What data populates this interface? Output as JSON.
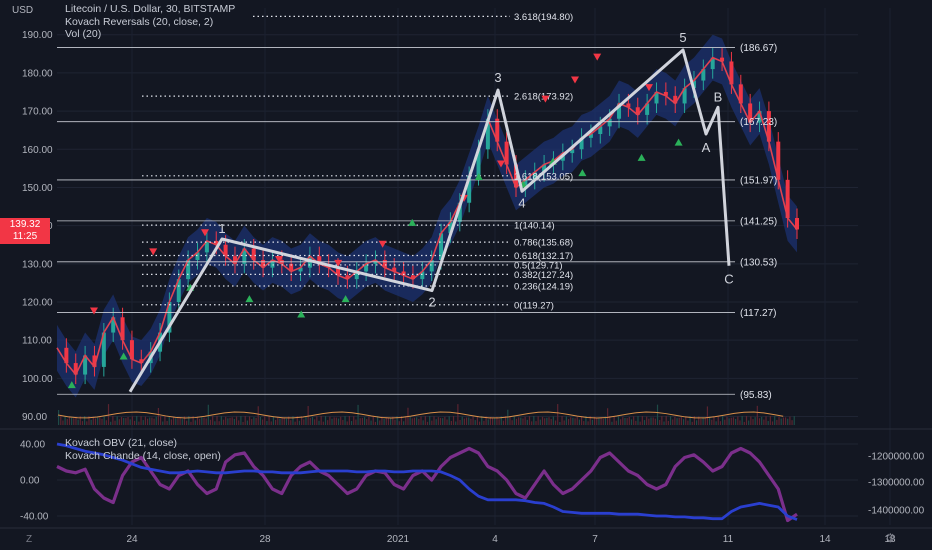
{
  "header": {
    "currency": "USD"
  },
  "legend": {
    "main": "Litecoin / U.S. Dollar, 30, BITSTAMP",
    "ind1": "Kovach Reversals (20, close, 2)",
    "ind2": "Vol (20)"
  },
  "lower_legend": {
    "ind1": "Kovach OBV (21, close)",
    "ind2": "Kovach Chande (14, close, open)"
  },
  "price_tag": {
    "price": "139.32",
    "time": "11:25"
  },
  "bottom_bar": {
    "z_label": "Z",
    "settings_icon": "gear-icon"
  },
  "colors": {
    "bg": "#131722",
    "red": "#f23645",
    "green": "#26a69a",
    "wave": "#d1d4dc",
    "obv": "#2a3fcf",
    "chande": "#7b2f8b"
  },
  "chart_data": [
    {
      "type": "line",
      "title": "Litecoin / U.S. Dollar, 30, BITSTAMP",
      "y_ticks": [
        90,
        100,
        110,
        120,
        130,
        140,
        150,
        160,
        170,
        180,
        190
      ],
      "y_tick_labels": [
        "90.00",
        "100.00",
        "110.00",
        "120.00",
        "130.00",
        "140.00",
        "150.00",
        "160.00",
        "170.00",
        "180.00",
        "190.00"
      ],
      "x_tick_labels": [
        "24",
        "28",
        "2021",
        "4",
        "7",
        "11",
        "14",
        "18"
      ],
      "ylim": [
        87,
        197
      ],
      "grid": true,
      "elliott_wave": {
        "points": [
          [
            "0",
            96.5
          ],
          [
            "1",
            136.5
          ],
          [
            "2",
            123
          ],
          [
            "3",
            175.5
          ],
          [
            "4",
            149
          ],
          [
            "5",
            186
          ],
          [
            "A",
            164
          ],
          [
            "B",
            171
          ],
          [
            "C",
            129.5
          ]
        ],
        "labels": [
          "1",
          "2",
          "3",
          "4",
          "5",
          "A",
          "B",
          "C"
        ]
      },
      "price_series": {
        "name": "close",
        "values": [
          108,
          104,
          101,
          106,
          103,
          112,
          116,
          110,
          105,
          104,
          107,
          112,
          120,
          126,
          131,
          133,
          136,
          135,
          132,
          130,
          134,
          131,
          129,
          131,
          130,
          128,
          129,
          132,
          130,
          129,
          127,
          126,
          128,
          130,
          131,
          129,
          128,
          127,
          126,
          128,
          131,
          138,
          141,
          146,
          153,
          160,
          168,
          162,
          156,
          150,
          152,
          154,
          156,
          157,
          159,
          160,
          163,
          164,
          166,
          168,
          172,
          171,
          169,
          172,
          175,
          174,
          172,
          176,
          178,
          181,
          184,
          183,
          177,
          172,
          167,
          170,
          162,
          152,
          142,
          139
        ]
      },
      "fib_levels": [
        {
          "label": "3.618(194.80)",
          "value": 194.8
        },
        {
          "label": "2.618(173.92)",
          "value": 173.92
        },
        {
          "label": "1.618(153.05)",
          "value": 153.05
        },
        {
          "label": "1(140.14)",
          "value": 140.14
        },
        {
          "label": "0.786(135.68)",
          "value": 135.68
        },
        {
          "label": "0.618(132.17)",
          "value": 132.17
        },
        {
          "label": "0.5(129.71)",
          "value": 129.71
        },
        {
          "label": "0.382(127.24)",
          "value": 127.24
        },
        {
          "label": "0.236(124.19)",
          "value": 124.19
        },
        {
          "label": "0(119.27)",
          "value": 119.27
        }
      ],
      "horizontal_levels": [
        {
          "label": "(186.67)",
          "value": 186.67
        },
        {
          "label": "(167.23)",
          "value": 167.23
        },
        {
          "label": "(151.97)",
          "value": 151.97
        },
        {
          "label": "(141.25)",
          "value": 141.25
        },
        {
          "label": "(130.53)",
          "value": 130.53
        },
        {
          "label": "(117.27)",
          "value": 117.27
        },
        {
          "label": "(95.83)",
          "value": 95.83
        }
      ],
      "reversal_markers": {
        "down": [
          [
            0.05,
            117.5
          ],
          [
            0.13,
            133
          ],
          [
            0.2,
            138
          ],
          [
            0.3,
            131
          ],
          [
            0.38,
            130
          ],
          [
            0.44,
            135
          ],
          [
            0.55,
            147
          ],
          [
            0.6,
            156
          ],
          [
            0.66,
            173
          ],
          [
            0.7,
            178
          ],
          [
            0.73,
            184
          ],
          [
            0.8,
            176
          ]
        ],
        "up": [
          [
            0.02,
            98.5
          ],
          [
            0.09,
            106
          ],
          [
            0.18,
            124
          ],
          [
            0.26,
            121
          ],
          [
            0.33,
            117
          ],
          [
            0.39,
            121
          ],
          [
            0.48,
            141
          ],
          [
            0.57,
            153
          ],
          [
            0.63,
            151
          ],
          [
            0.67,
            157
          ],
          [
            0.71,
            154
          ],
          [
            0.79,
            158
          ],
          [
            0.84,
            162
          ]
        ]
      }
    },
    {
      "type": "line",
      "title": "Kovach OBV / Kovach Chande",
      "left_y_tick_labels": [
        "40.00",
        "0.00",
        "-40.00"
      ],
      "left_y_ticks": [
        40,
        0,
        -40
      ],
      "right_y_tick_labels": [
        "-1200000.00",
        "-1300000.00",
        "-1400000.00"
      ],
      "series": [
        {
          "name": "Kovach OBV (21, close)",
          "values": [
            40,
            38,
            35,
            32,
            30,
            28,
            25,
            22,
            18,
            14,
            12,
            10,
            8,
            8,
            9,
            10,
            9,
            8,
            8,
            9,
            10,
            10,
            9,
            9,
            8,
            8,
            8,
            9,
            10,
            10,
            10,
            10,
            9,
            9,
            10,
            10,
            9,
            9,
            10,
            10,
            10,
            9,
            5,
            0,
            -10,
            -18,
            -22,
            -22,
            -22,
            -22,
            -23,
            -25,
            -26,
            -30,
            -35,
            -36,
            -37,
            -37,
            -37,
            -37,
            -38,
            -38,
            -38,
            -39,
            -40,
            -40,
            -41,
            -41,
            -42,
            -42,
            -43,
            -43,
            -35,
            -30,
            -28,
            -26,
            -28,
            -30,
            -40,
            -44
          ]
        },
        {
          "name": "Kovach Chande (14, close, open)",
          "values": [
            15,
            10,
            8,
            12,
            -10,
            -20,
            -25,
            5,
            20,
            25,
            10,
            -5,
            -10,
            5,
            10,
            -5,
            -15,
            -10,
            20,
            28,
            30,
            15,
            5,
            -10,
            -15,
            5,
            15,
            20,
            10,
            5,
            -5,
            -15,
            -10,
            5,
            10,
            8,
            -5,
            -10,
            5,
            10,
            0,
            15,
            25,
            30,
            35,
            30,
            15,
            10,
            0,
            -15,
            -20,
            -5,
            10,
            -5,
            -15,
            -10,
            0,
            10,
            25,
            30,
            20,
            10,
            5,
            -5,
            -10,
            -5,
            15,
            25,
            28,
            20,
            10,
            15,
            30,
            35,
            30,
            20,
            5,
            -10,
            -45,
            -38
          ]
        }
      ]
    }
  ]
}
